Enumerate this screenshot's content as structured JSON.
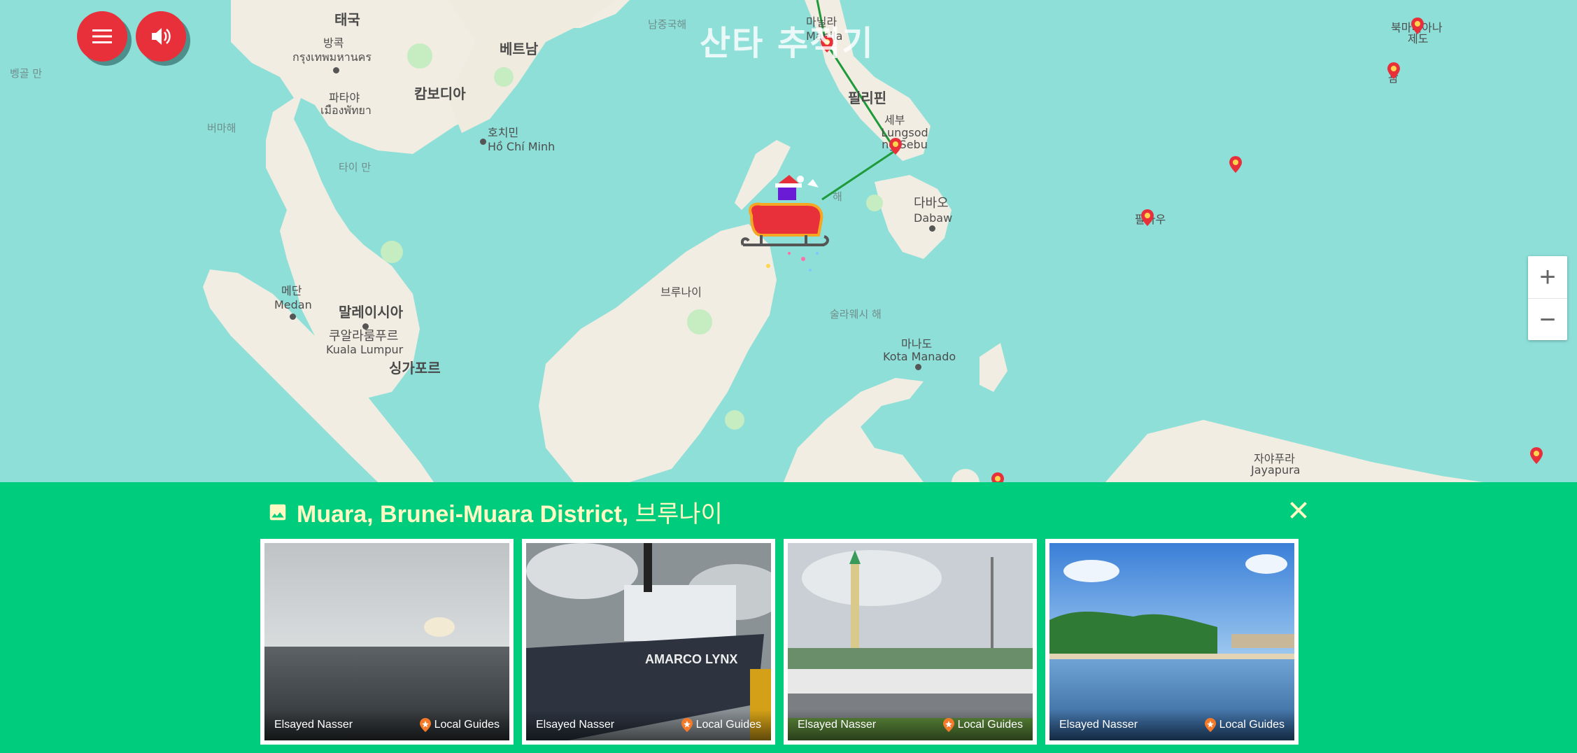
{
  "app": {
    "title": "산타 추적기"
  },
  "controls": {
    "menu_icon": "hamburger-menu-icon",
    "sound_icon": "speaker-icon",
    "zoom_in": "+",
    "zoom_out": "−"
  },
  "map": {
    "labels": {
      "thailand": "태국",
      "bangkok_ko": "방콕",
      "bangkok_th": "กรุงเทพมหานคร",
      "vietnam": "베트남",
      "pattaya_ko": "파타야",
      "pattaya_th": "เมืองพัทยา",
      "cambodia": "캄보디아",
      "hcm_ko": "호치민",
      "hcm_en": "Hồ Chí Minh",
      "philippines": "필리핀",
      "cebu_ko": "세부",
      "cebu_en": "Lungsod ng Sebu",
      "manila_ko": "마닐라",
      "manila_en": "Manila",
      "davao_ko": "다바오",
      "davao_en": "Dabaw",
      "palau": "팔라우",
      "nmi_1": "북마리아나",
      "nmi_2": "제도",
      "guam": "괌",
      "scs": "남중국해",
      "bay_bengal": "벵골 만",
      "andaman": "버마해",
      "gulf_thailand": "타이 만",
      "brunei": "브루나이",
      "sulu_suffix": "해",
      "celebes": "술라웨시 해",
      "medan_ko": "메단",
      "medan_en": "Medan",
      "malaysia": "말레이시아",
      "kl_ko": "쿠알라룸푸르",
      "kl_en": "Kuala Lumpur",
      "singapore": "싱가포르",
      "manado_ko": "마나도",
      "manado_en": "Kota Manado",
      "jayapura_ko": "자야푸라",
      "jayapura_en": "Jayapura"
    }
  },
  "panel": {
    "place_bold": "Muara, Brunei-Muara District,",
    "place_country": "브루나이",
    "photo_icon": "photo-icon",
    "close_icon": "close-icon",
    "photos": [
      {
        "author": "Elsayed Nasser",
        "badge": "Local Guides",
        "scene": "sea"
      },
      {
        "author": "Elsayed Nasser",
        "badge": "Local Guides",
        "scene": "ship"
      },
      {
        "author": "Elsayed Nasser",
        "badge": "Local Guides",
        "scene": "mosque"
      },
      {
        "author": "Elsayed Nasser",
        "badge": "Local Guides",
        "scene": "beach"
      }
    ],
    "ship_text": "AMARCO LYNX"
  },
  "colors": {
    "ocean": "#8ddfd8",
    "land": "#f2ede2",
    "panel": "#00cc7d",
    "accent_red": "#e8303a",
    "route": "#1e9a3a",
    "place_text": "#fff9c4"
  }
}
